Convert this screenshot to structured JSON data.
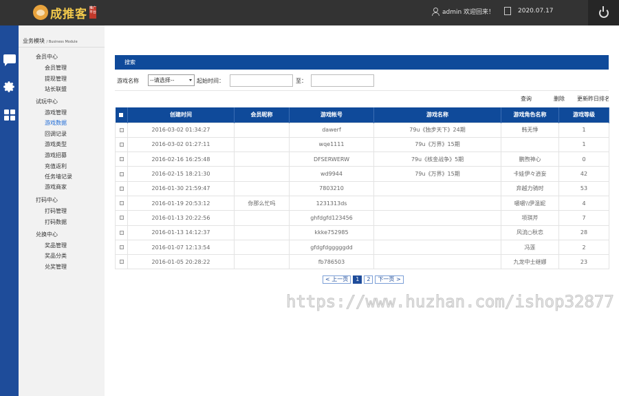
{
  "header": {
    "logo_text": "成推客",
    "logo_seal": "推广平台",
    "user_label": "admin 欢迎回来！",
    "date": "2020.07.17"
  },
  "icons": {
    "iconbar": [
      "chat-icon",
      "gear-icon",
      "grid-icon"
    ],
    "user": "user-icon",
    "date": "document-icon",
    "power": "power-icon"
  },
  "sidebar": {
    "module_title": "业务模块",
    "module_subtitle": "/ Business Module",
    "groups": [
      {
        "label": "会员中心",
        "items": [
          "会员管理",
          "提现管理",
          "站长联盟"
        ]
      },
      {
        "label": "试玩中心",
        "items": [
          "游戏管理",
          "游戏数据",
          "回调记录",
          "游戏类型",
          "游戏招募",
          "充值返利",
          "任务墙记录",
          "游戏商家"
        ]
      },
      {
        "label": "打码中心",
        "items": [
          "打码管理",
          "打码数据"
        ]
      },
      {
        "label": "兑换中心",
        "items": [
          "奖品管理",
          "奖品分类",
          "兑奖管理"
        ]
      }
    ],
    "active_item": "游戏数据"
  },
  "panel": {
    "title": "搜索"
  },
  "filters": {
    "game_name_label": "游戏名称",
    "game_select_value": "--请选择--",
    "start_time_label": "起始时间：",
    "to_label": "至："
  },
  "actions": {
    "search": "查询",
    "delete": "删除",
    "update_rank": "更新昨日排名"
  },
  "table": {
    "headers": [
      "创建时间",
      "会员昵称",
      "游戏帐号",
      "游戏名称",
      "游戏角色名称",
      "游戏等级"
    ],
    "rows": [
      [
        "2016-03-02 01:34:27",
        "",
        "dawerf",
        "79u《独步天下》24期",
        "韩无悸",
        "1"
      ],
      [
        "2016-03-02 01:27:11",
        "",
        "wqe1111",
        "79u《万界》15期",
        "",
        "1"
      ],
      [
        "2016-02-16 16:25:48",
        "",
        "DFSERWERW",
        "79u《核金战争》5期",
        "鹏煦神心",
        "0"
      ],
      [
        "2016-02-15 18:21:30",
        "",
        "wd9944",
        "79u《万界》15期",
        "卡娃伊々逍妄",
        "42"
      ],
      [
        "2016-01-30 21:59:47",
        "",
        "7803210",
        "",
        "弃越力骑时",
        "53"
      ],
      [
        "2016-01-19 20:53:12",
        "你那么忙吗",
        "1231313ds",
        "",
        "嚼嚼\\\\伊温妮",
        "4"
      ],
      [
        "2016-01-13 20:22:56",
        "",
        "ghfdgfd123456",
        "",
        "项琪芹",
        "7"
      ],
      [
        "2016-01-13 14:12:37",
        "",
        "kkke752985",
        "",
        "风流○秋恋",
        "28"
      ],
      [
        "2016-01-07 12:13:54",
        "",
        "gfdgfdgggggdd",
        "",
        "冯莲",
        "2"
      ],
      [
        "2016-01-05 20:28:22",
        "",
        "fb786503",
        "",
        "九龙中士继娜",
        "23"
      ]
    ]
  },
  "pagination": {
    "prev": "< 上一页",
    "pages": [
      "1",
      "2"
    ],
    "next": "下一页 >"
  },
  "watermark": "https://www.huzhan.com/ishop32877"
}
